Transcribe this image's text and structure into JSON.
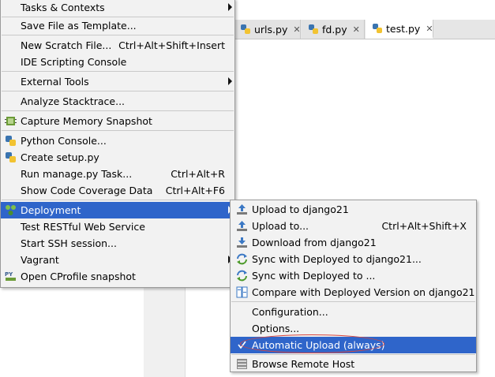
{
  "editor": {
    "tabs": [
      {
        "label": "urls.py",
        "close": "✕"
      },
      {
        "label": "fd.py",
        "close": "✕"
      },
      {
        "label": "test.py",
        "close": "✕",
        "active": true
      }
    ]
  },
  "main_menu": {
    "items": [
      {
        "label": "Tasks & Contexts",
        "mnemonic_index": 0,
        "submenu": true
      },
      {
        "label": "Save File as Template..."
      },
      {
        "label": "New Scratch File...",
        "shortcut": "Ctrl+Alt+Shift+Insert"
      },
      {
        "label": "IDE Scripting Console"
      },
      {
        "label": "External Tools",
        "submenu": true
      },
      {
        "label": "Analyze Stacktrace..."
      },
      {
        "label": "Capture Memory Snapshot",
        "icon": "memory-snapshot-icon"
      },
      {
        "label": "Python Console...",
        "icon": "python-icon"
      },
      {
        "label": "Create setup.py",
        "icon": "python-icon"
      },
      {
        "label": "Run manage.py Task...",
        "shortcut": "Ctrl+Alt+R"
      },
      {
        "label": "Show Code Coverage Data",
        "shortcut": "Ctrl+Alt+F6"
      },
      {
        "label": "Deployment",
        "icon": "deployment-icon",
        "submenu": true,
        "selected": true
      },
      {
        "label": "Test RESTful Web Service"
      },
      {
        "label": "Start SSH session..."
      },
      {
        "label": "Vagrant",
        "submenu": true
      },
      {
        "label": "Open CProfile snapshot",
        "icon": "profile-py-icon"
      }
    ]
  },
  "deployment_menu": {
    "items": [
      {
        "label": "Upload to django21",
        "icon": "upload-icon"
      },
      {
        "label": "Upload to...",
        "shortcut": "Ctrl+Alt+Shift+X",
        "icon": "upload-icon"
      },
      {
        "label": "Download from django21",
        "icon": "download-icon"
      },
      {
        "label": "Sync with Deployed to django21...",
        "icon": "sync-icon"
      },
      {
        "label": "Sync with Deployed to ...",
        "icon": "sync-icon"
      },
      {
        "label": "Compare with Deployed Version on django21",
        "icon": "compare-icon"
      },
      {
        "label": "Configuration..."
      },
      {
        "label": "Options..."
      },
      {
        "label": "Automatic Upload (always)",
        "checked": true,
        "selected": true
      },
      {
        "label": "Browse Remote Host",
        "icon": "remote-host-icon"
      }
    ]
  },
  "colors": {
    "selection": "#2f65ca",
    "menu_bg": "#f2f2f2",
    "annotation": "#d8453d"
  }
}
